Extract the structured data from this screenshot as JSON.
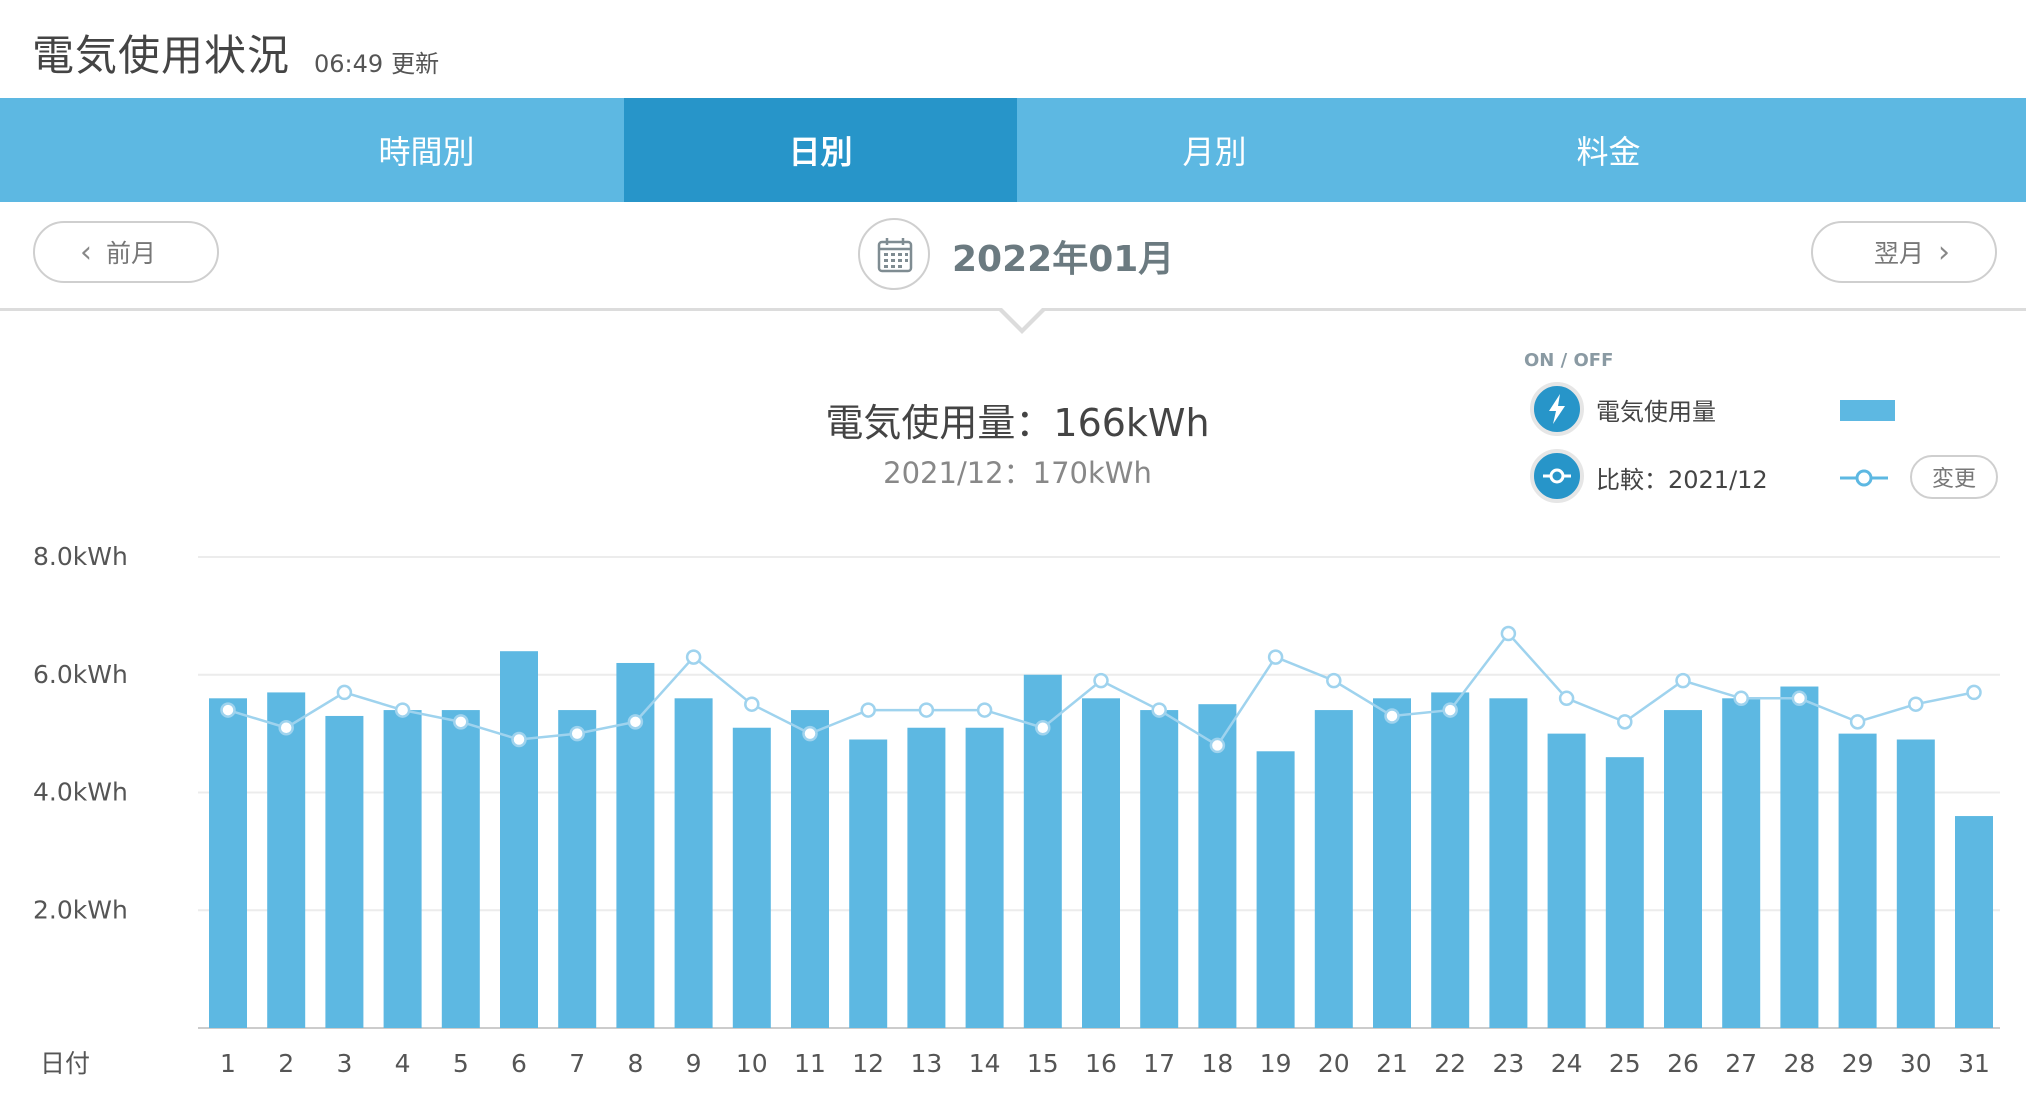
{
  "header": {
    "title": "電気使用状況",
    "time": "06:49",
    "updated_label": "更新"
  },
  "tabs": [
    {
      "label": "時間別",
      "active": false
    },
    {
      "label": "日別",
      "active": true
    },
    {
      "label": "月別",
      "active": false
    },
    {
      "label": "料金",
      "active": false
    }
  ],
  "nav": {
    "prev_label": "前月",
    "next_label": "翌月",
    "month": "2022年01月",
    "calendar_icon": "calendar-icon"
  },
  "summary": {
    "main": "電気使用量：166kWh",
    "compare": "2021/12：170kWh"
  },
  "legend": {
    "onoff": "ON / OFF",
    "usage_label": "電気使用量",
    "usage_icon": "lightning-icon",
    "compare_label": "比較：2021/12",
    "compare_icon": "comparison-line-icon",
    "change_label": "変更"
  },
  "colors": {
    "bar": "#5db8e2",
    "tab_bg": "#5db8e2",
    "tab_active": "#2795c9",
    "line": "#9fd3ee"
  },
  "chart_data": {
    "type": "bar",
    "title": "",
    "xlabel": "日付",
    "ylabel": "",
    "ylim": [
      0,
      8
    ],
    "yticks": [
      "8.0kWh",
      "6.0kWh",
      "4.0kWh",
      "2.0kWh"
    ],
    "ytick_values": [
      8,
      6,
      4,
      2
    ],
    "categories": [
      "1",
      "2",
      "3",
      "4",
      "5",
      "6",
      "7",
      "8",
      "9",
      "10",
      "11",
      "12",
      "13",
      "14",
      "15",
      "16",
      "17",
      "18",
      "19",
      "20",
      "21",
      "22",
      "23",
      "24",
      "25",
      "26",
      "27",
      "28",
      "29",
      "30",
      "31"
    ],
    "series": [
      {
        "name": "電気使用量",
        "type": "bar",
        "values": [
          5.6,
          5.7,
          5.3,
          5.4,
          5.4,
          6.4,
          5.4,
          6.2,
          5.6,
          5.1,
          5.4,
          4.9,
          5.1,
          5.1,
          6.0,
          5.6,
          5.4,
          5.5,
          4.7,
          5.4,
          5.6,
          5.7,
          5.6,
          5.0,
          4.6,
          5.4,
          5.6,
          5.8,
          5.0,
          4.9,
          3.6
        ]
      },
      {
        "name": "比較：2021/12",
        "type": "line",
        "values": [
          5.4,
          5.1,
          5.7,
          5.4,
          5.2,
          4.9,
          5.0,
          5.2,
          6.3,
          5.5,
          5.0,
          5.4,
          5.4,
          5.4,
          5.1,
          5.9,
          5.4,
          4.8,
          6.3,
          5.9,
          5.3,
          5.4,
          6.7,
          5.6,
          5.2,
          5.9,
          5.6,
          5.6,
          5.2,
          5.5,
          5.7
        ]
      }
    ]
  }
}
